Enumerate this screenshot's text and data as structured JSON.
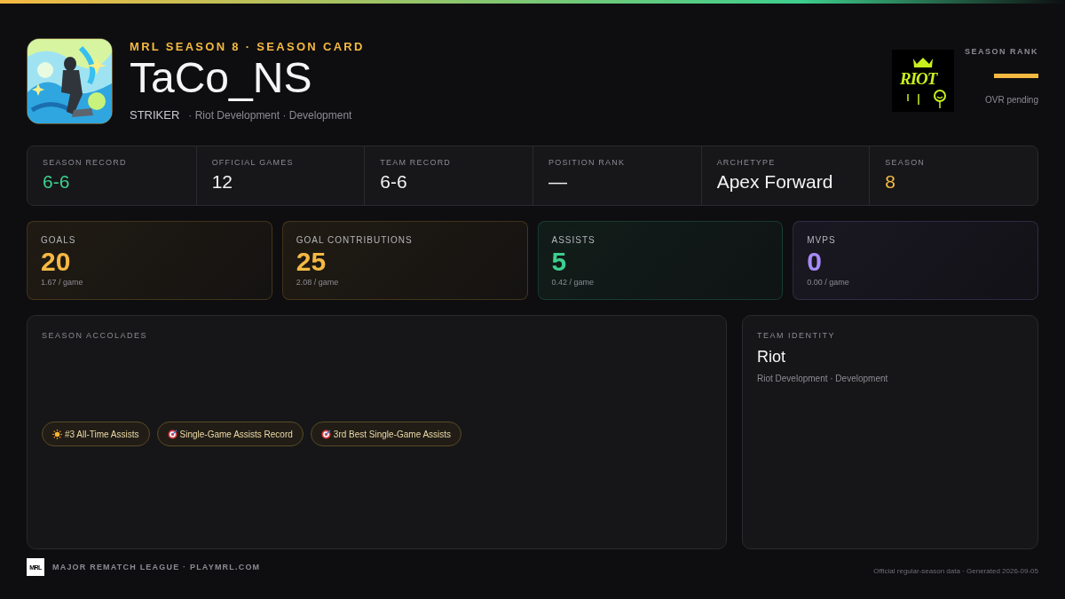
{
  "header": {
    "eyebrow": "MRL SEASON 8 · SEASON CARD",
    "player": "TaCo_NS",
    "position": "STRIKER",
    "team_line": "· Riot Development · Development"
  },
  "team_logo": {
    "text": "RIOT"
  },
  "season_rank": {
    "label": "SEASON RANK",
    "value": "—",
    "note": "OVR pending"
  },
  "summary": [
    {
      "label": "SEASON RECORD",
      "value": "6-6",
      "color": "#3ecf8e"
    },
    {
      "label": "OFFICIAL GAMES",
      "value": "12",
      "color": "#f2f2f4"
    },
    {
      "label": "TEAM RECORD",
      "value": "6-6",
      "color": "#f2f2f4"
    },
    {
      "label": "POSITION RANK",
      "value": "—",
      "color": "#f2f2f4"
    },
    {
      "label": "ARCHETYPE",
      "value": "Apex Forward",
      "color": "#f2f2f4"
    },
    {
      "label": "SEASON",
      "value": "8",
      "color": "#f5b942"
    }
  ],
  "stats": [
    {
      "label": "GOALS",
      "value": "20",
      "rate": "1.67 / game",
      "color": "#f5b942"
    },
    {
      "label": "GOAL CONTRIBUTIONS",
      "value": "25",
      "rate": "2.08 / game",
      "color": "#f5b942"
    },
    {
      "label": "ASSISTS",
      "value": "5",
      "rate": "0.42 / game",
      "color": "#3ecf8e"
    },
    {
      "label": "MVPS",
      "value": "0",
      "rate": "0.00 / game",
      "color": "#a78bfa"
    }
  ],
  "accolades": {
    "title": "SEASON ACCOLADES",
    "items": [
      {
        "kind": "sun",
        "text": "#3 All-Time Assists"
      },
      {
        "kind": "target",
        "text": "Single-Game Assists Record"
      },
      {
        "kind": "target",
        "text": "3rd Best Single-Game Assists"
      }
    ]
  },
  "team_identity": {
    "title": "TEAM IDENTITY",
    "name": "Riot",
    "detail": "Riot Development · Development"
  },
  "footer": {
    "logo": "MRL",
    "brand": "MAJOR REMATCH LEAGUE · PLAYMRL.COM",
    "note": "Official regular-season data · Generated 2026-09-05"
  }
}
